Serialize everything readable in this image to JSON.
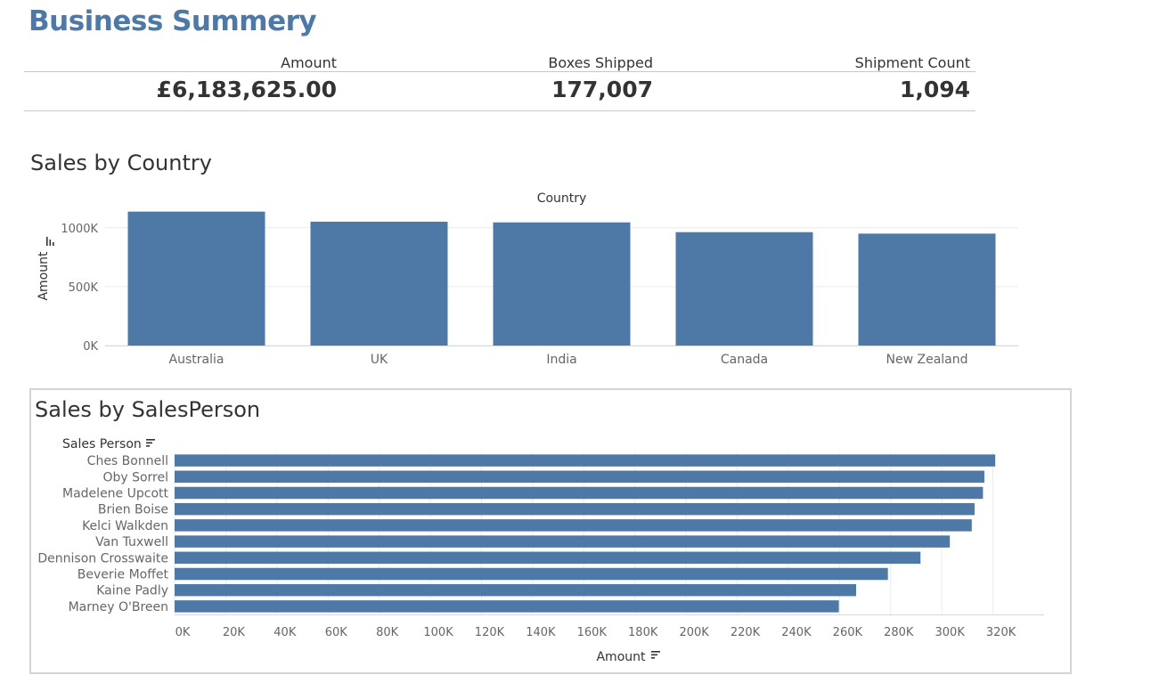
{
  "header": {
    "title": "Business Summery"
  },
  "kpis": [
    {
      "label": "Amount",
      "value": "£6,183,625.00"
    },
    {
      "label": "Boxes Shipped",
      "value": "177,007"
    },
    {
      "label": "Shipment Count",
      "value": "1,094"
    }
  ],
  "colors": {
    "bar": "#4e79a7",
    "title": "#4e79a7",
    "grid": "#ebebeb"
  },
  "country_section": {
    "title": "Sales by Country"
  },
  "salesperson_section": {
    "title": "Sales by SalesPerson"
  },
  "chart_data": [
    {
      "type": "bar",
      "orientation": "vertical",
      "title": "Sales by Country",
      "column_header": "Country",
      "ylabel": "Amount",
      "sort_icon": "sort-icon",
      "categories": [
        "Australia",
        "UK",
        "India",
        "Canada",
        "New Zealand"
      ],
      "values": [
        1137281,
        1051792,
        1045800,
        962899,
        950418
      ],
      "ylim": [
        0,
        1180000
      ],
      "yticks": [
        0,
        500000,
        1000000
      ],
      "ytick_labels": [
        "0K",
        "500K",
        "1000K"
      ],
      "grid": true
    },
    {
      "type": "bar",
      "orientation": "horizontal",
      "title": "Sales by SalesPerson",
      "row_header": "Sales Person",
      "xlabel": "Amount",
      "sort_icon": "sort-icon",
      "categories": [
        "Ches Bonnell",
        "Oby Sorrel",
        "Madelene Upcott",
        "Brien Boise",
        "Kelci Walkden",
        "Van Tuxwell",
        "Dennison Crosswaite",
        "Beverie Moffet",
        "Kaine Padly",
        "Marney O'Breen"
      ],
      "values": [
        320901,
        316645,
        316099,
        312816,
        311710,
        303149,
        291669,
        278922,
        266490,
        259742
      ],
      "xlim": [
        0,
        340000
      ],
      "xticks": [
        0,
        20000,
        40000,
        60000,
        80000,
        100000,
        120000,
        140000,
        160000,
        180000,
        200000,
        220000,
        240000,
        260000,
        280000,
        300000,
        320000
      ],
      "xtick_labels": [
        "0K",
        "20K",
        "40K",
        "60K",
        "80K",
        "100K",
        "120K",
        "140K",
        "160K",
        "180K",
        "200K",
        "220K",
        "240K",
        "260K",
        "280K",
        "300K",
        "320K"
      ],
      "grid": true
    }
  ]
}
